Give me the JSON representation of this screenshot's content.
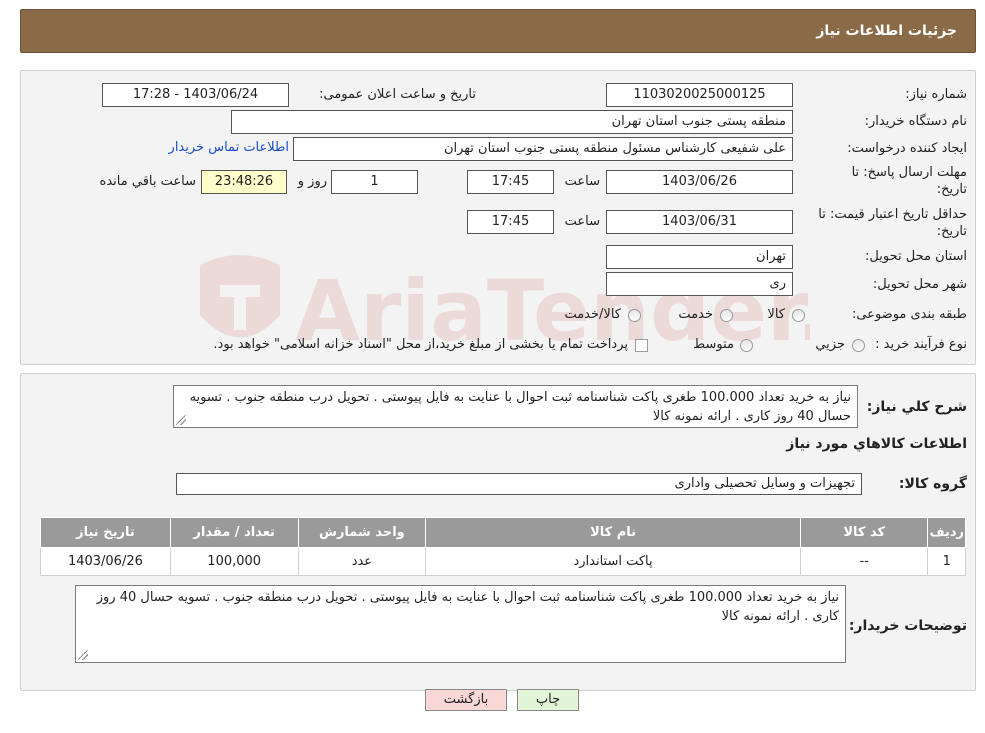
{
  "header": {
    "title": "جزئیات اطلاعات نیاز"
  },
  "form": {
    "need_number_label": "شماره نیاز:",
    "need_number": "1103020025000125",
    "announce_label": "تاریخ و ساعت اعلان عمومی:",
    "announce_value": "1403/06/24 - 17:28",
    "buyer_org_label": "نام دستگاه خریدار:",
    "buyer_org": "منطقه پستی جنوب استان تهران",
    "creator_label": "ایجاد کننده درخواست:",
    "creator": "علی شفیعی کارشناس مسئول منطقه پستی جنوب استان تهران",
    "contact_link": "اطلاعات تماس خریدار",
    "deadline_label_1": "مهلت ارسال پاسخ: تا",
    "deadline_label_2": "تاریخ:",
    "deadline_date": "1403/06/26",
    "time_label": "ساعت",
    "deadline_time": "17:45",
    "days_value": "1",
    "days_label": "روز و",
    "remaining_time": "23:48:26",
    "remaining_label": "ساعت باقي مانده",
    "validity_label_1": "حداقل تاریخ اعتبار قیمت: تا",
    "validity_label_2": "تاریخ:",
    "validity_date": "1403/06/31",
    "validity_time": "17:45",
    "province_label": "استان محل تحویل:",
    "province": "تهران",
    "city_label": "شهر محل تحویل:",
    "city": "ری",
    "category_label": "طبقه بندی موضوعی:",
    "category_options": [
      "کالا",
      "خدمت",
      "کالا/خدمت"
    ],
    "process_label": "نوع فرآیند خرید :",
    "process_options": [
      "جزیي",
      "متوسط"
    ],
    "process_note": "پرداخت تمام یا بخشی از مبلغ خرید،از محل \"اسناد خزانه اسلامی\" خواهد بود."
  },
  "description": {
    "label": "شرح کلي نیاز:",
    "text": "نیاز به خرید تعداد 100.000 طغری پاکت شناسنامه ثبت احوال با عنایت به فایل پیوستی . تحویل درب منطقه جنوب . تسویه حسال 40 روز کاری . ارائه نمونه کالا"
  },
  "goods": {
    "section_title": "اطلاعات کالاهاي مورد نیاز",
    "group_label": "گروه کالا:",
    "group_value": "تجهیزات و وسایل تحصیلی واداری",
    "columns": [
      "ردیف",
      "کد کالا",
      "نام کالا",
      "واحد شمارش",
      "تعداد / مقدار",
      "تاریخ نیاز"
    ],
    "rows": [
      [
        "1",
        "--",
        "پاکت استاندارد",
        "عدد",
        "100,000",
        "1403/06/26"
      ]
    ]
  },
  "buyer_notes": {
    "label": "توضیحات خریدار:",
    "text": "نیاز به خرید تعداد 100.000 طغری پاکت شناسنامه ثبت احوال با عنایت به فایل پیوستی . تحویل درب منطقه جنوب . تسویه حسال 40 روز کاری . ارائه نمونه کالا"
  },
  "buttons": {
    "print": "چاپ",
    "back": "بازگشت"
  },
  "watermark": {
    "text": "AriaTender.neT"
  },
  "colors": {
    "header": "#8b6b47",
    "link": "#1a4ec8",
    "table_header": "#9a9a9a",
    "back_button": "#f8d7d7",
    "print_button": "#e3f5d9"
  }
}
